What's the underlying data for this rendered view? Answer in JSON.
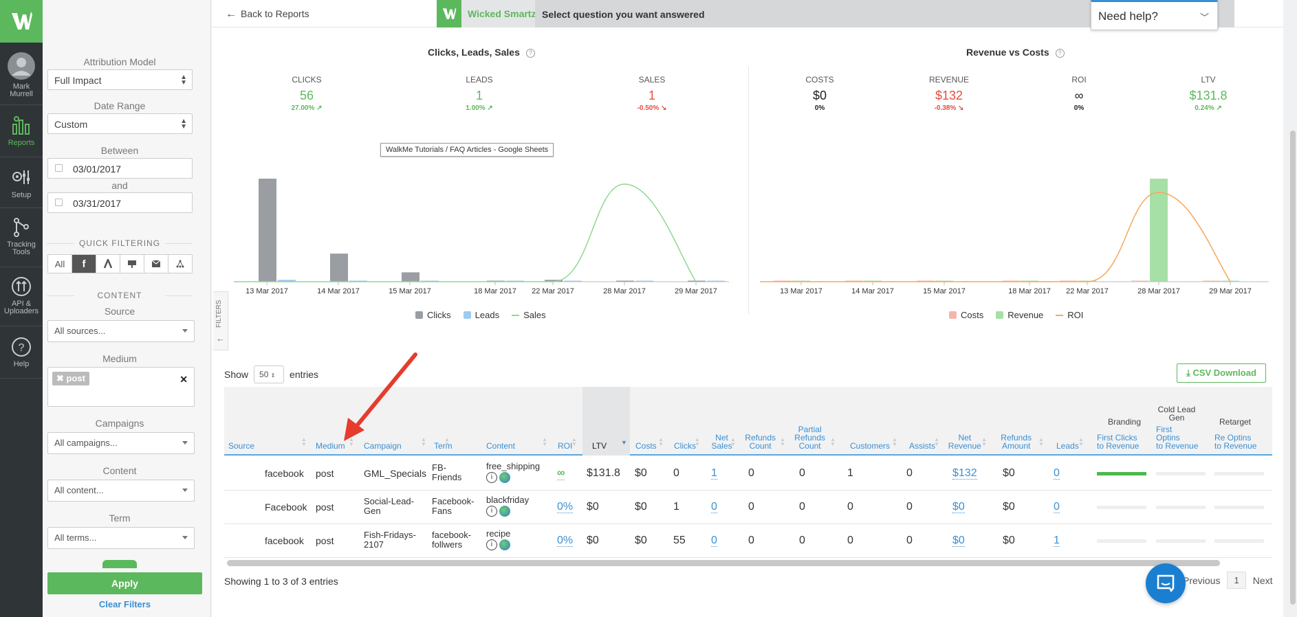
{
  "nav": {
    "user": "Mark Murrell",
    "reports": "Reports",
    "setup": "Setup",
    "tracking": "Tracking Tools",
    "api": "API & Uploaders",
    "help": "Help"
  },
  "filters": {
    "attribution_label": "Attribution Model",
    "attribution_value": "Full Impact",
    "date_range_label": "Date Range",
    "date_range_value": "Custom",
    "between_label": "Between",
    "start_date": "03/01/2017",
    "and_label": "and",
    "end_date": "03/31/2017",
    "quick_filtering": "QUICK FILTERING",
    "quick_all": "All",
    "content_section": "CONTENT",
    "source_label": "Source",
    "source_value": "All sources...",
    "medium_label": "Medium",
    "medium_tag": "post",
    "campaigns_label": "Campaigns",
    "campaigns_value": "All campaigns...",
    "content_label": "Content",
    "content_value": "All content...",
    "term_label": "Term",
    "term_value": "All terms...",
    "apply": "Apply",
    "clear": "Clear Filters",
    "tab": "FILTERS"
  },
  "topbar": {
    "back": "Back to Reports",
    "ws_name": "Wicked Smartz:",
    "ws_question": "Select question you want answered",
    "need_help": "Need help?"
  },
  "chart1": {
    "title": "Clicks, Leads, Sales",
    "kpis": [
      {
        "label": "CLICKS",
        "value": "56",
        "change": "27.00% ↗"
      },
      {
        "label": "LEADS",
        "value": "1",
        "change": "1.00% ↗"
      },
      {
        "label": "SALES",
        "value": "1",
        "change": "-0.50% ↘"
      }
    ],
    "tooltip": "WalkMe Tutorials / FAQ Articles - Google Sheets"
  },
  "chart2": {
    "title": "Revenue vs Costs",
    "kpis": [
      {
        "label": "COSTS",
        "value": "$0",
        "change": "0%"
      },
      {
        "label": "REVENUE",
        "value": "$132",
        "change": "-0.38% ↘"
      },
      {
        "label": "ROI",
        "value": "∞",
        "change": "0%"
      },
      {
        "label": "LTV",
        "value": "$131.8",
        "change": "0.24% ↗"
      }
    ]
  },
  "chart_data": [
    {
      "type": "bar",
      "title": "Clicks, Leads, Sales",
      "categories": [
        "13 Mar 2017",
        "14 Mar 2017",
        "15 Mar 2017",
        "18 Mar 2017",
        "22 Mar 2017",
        "28 Mar 2017",
        "29 Mar 2017"
      ],
      "series": [
        {
          "name": "Clicks",
          "color": "#9a9ea3",
          "values": [
            55,
            15,
            5,
            0,
            1,
            0,
            0
          ]
        },
        {
          "name": "Leads",
          "color": "#9ccbf0",
          "values": [
            1,
            0,
            0,
            0,
            0,
            0,
            0
          ]
        },
        {
          "name": "Sales",
          "color": "#90d890",
          "values": [
            0,
            0,
            0,
            0,
            0,
            1,
            0
          ]
        }
      ],
      "legend": "bottom"
    },
    {
      "type": "bar",
      "title": "Revenue vs Costs",
      "categories": [
        "13 Mar 2017",
        "14 Mar 2017",
        "15 Mar 2017",
        "18 Mar 2017",
        "22 Mar 2017",
        "28 Mar 2017",
        "29 Mar 2017"
      ],
      "series": [
        {
          "name": "Costs",
          "color": "#f4b6aa",
          "values": [
            0,
            0,
            0,
            0,
            0,
            0,
            0
          ]
        },
        {
          "name": "Revenue",
          "color": "#a6e0a6",
          "values": [
            0,
            0,
            0,
            0,
            0,
            132,
            0
          ]
        },
        {
          "name": "ROI",
          "color": "#f4a85a",
          "values": [
            0,
            0,
            0,
            0,
            0,
            1,
            0
          ]
        }
      ],
      "legend": "bottom"
    }
  ],
  "table": {
    "show_label": "Show",
    "page_size": "50",
    "entries_label": "entries",
    "csv": "CSV Download",
    "group_headers": [
      "Branding",
      "Cold Lead Gen",
      "Retarget"
    ],
    "columns": [
      "Source",
      "Medium",
      "Campaign",
      "Term",
      "Content",
      "ROI",
      "LTV",
      "Costs",
      "Clicks",
      "Net Sales",
      "Refunds Count",
      "Partial Refunds Count",
      "Customers",
      "Assists",
      "Net Revenue",
      "Refunds Amount",
      "Leads",
      "First Clicks to Revenue",
      "First Optins to Revenue",
      "Re Optins to Revenue"
    ],
    "rows": [
      {
        "source": "facebook",
        "medium": "post",
        "campaign": "GML_Specials",
        "term": "FB-Friends",
        "content": "free_shipping",
        "roi": "∞",
        "ltv": "$131.8",
        "costs": "$0",
        "clicks": "0",
        "net_sales": "1",
        "refunds_count": "0",
        "partial_refunds": "0",
        "customers": "1",
        "assists": "0",
        "net_revenue": "$132",
        "refunds_amount": "$0",
        "leads": "0",
        "branding": 1,
        "cold": 0,
        "retarget": 0
      },
      {
        "source": "Facebook",
        "medium": "post",
        "campaign": "Social-Lead-Gen",
        "term": "Facebook-Fans",
        "content": "blackfriday",
        "roi": "0%",
        "ltv": "$0",
        "costs": "$0",
        "clicks": "1",
        "net_sales": "0",
        "refunds_count": "0",
        "partial_refunds": "0",
        "customers": "0",
        "assists": "0",
        "net_revenue": "$0",
        "refunds_amount": "$0",
        "leads": "0",
        "branding": 0,
        "cold": 0,
        "retarget": 0
      },
      {
        "source": "facebook",
        "medium": "post",
        "campaign": "Fish-Fridays-2107",
        "term": "facebook-follwers",
        "content": "recipe",
        "roi": "0%",
        "ltv": "$0",
        "costs": "$0",
        "clicks": "55",
        "net_sales": "0",
        "refunds_count": "0",
        "partial_refunds": "0",
        "customers": "0",
        "assists": "0",
        "net_revenue": "$0",
        "refunds_amount": "$0",
        "leads": "1",
        "branding": 0,
        "cold": 0,
        "retarget": 0
      }
    ],
    "showing": "Showing 1 to 3 of 3 entries",
    "previous": "Previous",
    "page": "1",
    "next": "Next"
  }
}
